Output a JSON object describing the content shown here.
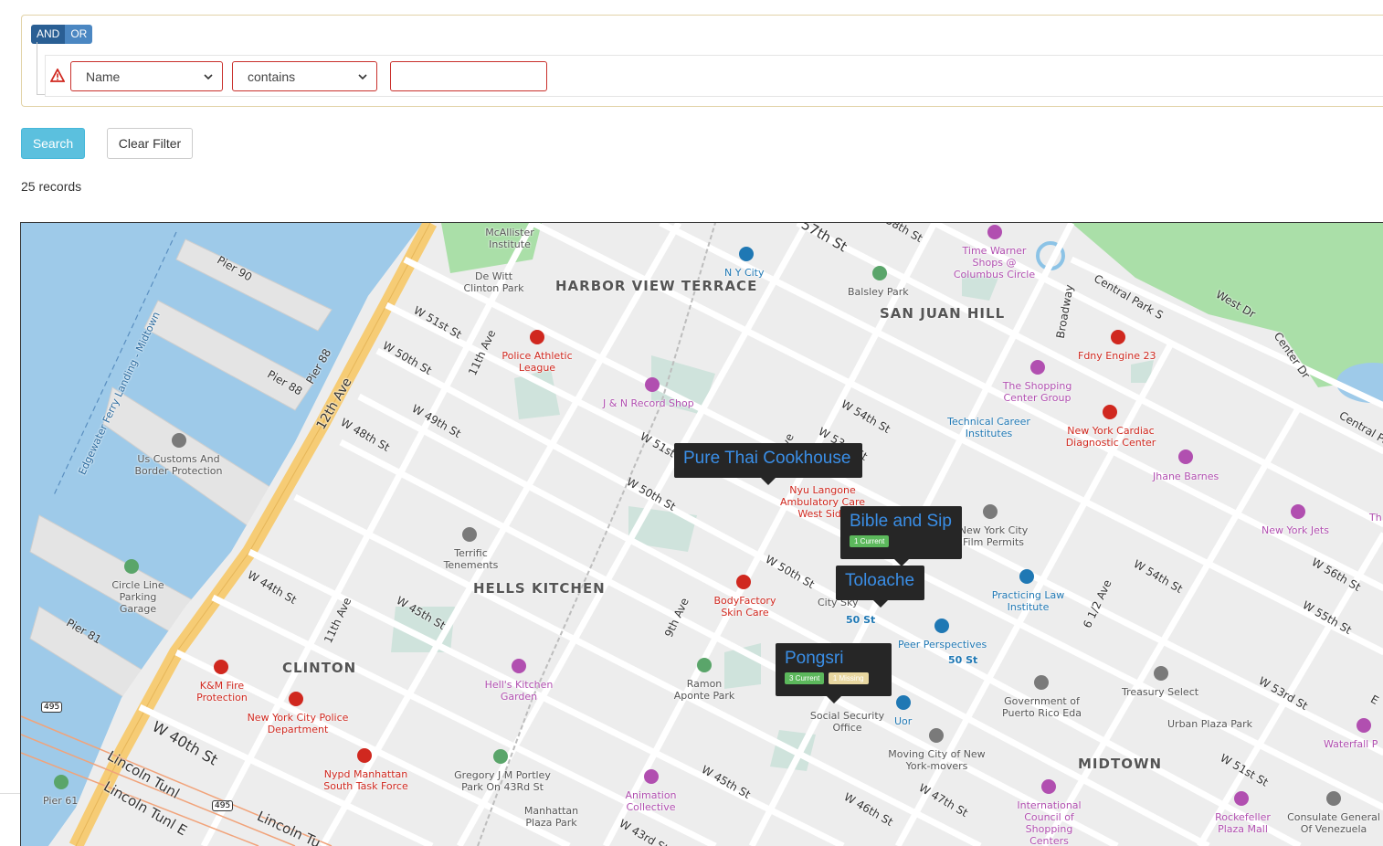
{
  "filter": {
    "and_label": "AND",
    "or_label": "OR",
    "field_value": "Name",
    "operator_value": "contains",
    "text_value": ""
  },
  "buttons": {
    "search_label": "Search",
    "clear_label": "Clear Filter"
  },
  "records_label": "25 records",
  "map": {
    "areas": [
      "HARBOR VIEW TERRACE",
      "SAN JUAN HILL",
      "HELLS KITCHEN",
      "CLINTON",
      "MIDTOWN"
    ],
    "streets": [
      "Pier 90",
      "Pier 88",
      "Pier 88",
      "Pier 81",
      "W 51st St",
      "W 50th St",
      "W 49th St",
      "W 48th St",
      "12th Ave",
      "11th Ave",
      "11th Ave",
      "W 44th St",
      "W 45th St",
      "W 40th St",
      "Lincoln Tunl",
      "Lincoln Tunl E",
      "Lincoln Tu",
      "57th St",
      "58th St",
      "Central Park S",
      "Broadway",
      "West Dr",
      "Center Dr",
      "Central Pa",
      "W 54th St",
      "W 53rd St",
      "W 51st St",
      "W 50th St",
      "9th Ave",
      "9th Ave",
      "W 50th St",
      "W 54th St",
      "W 56th St",
      "W 55th St",
      "6 1/2 Ave",
      "W 53rd St",
      "W 51st St",
      "W 45th St",
      "W 46th St",
      "W 47th St",
      "W 43rd St",
      "E",
      "Edgewater Ferry Landing - Midtown"
    ],
    "pois": [
      {
        "name": "McAllister Institute",
        "color": "gray"
      },
      {
        "name": "De Witt Clinton Park",
        "color": "gray"
      },
      {
        "name": "N Y City",
        "color": "blue"
      },
      {
        "name": "Balsley Park",
        "color": "gray"
      },
      {
        "name": "Time Warner Shops @ Columbus Circle",
        "color": "purple"
      },
      {
        "name": "Police Athletic League",
        "color": "red"
      },
      {
        "name": "Fdny Engine 23",
        "color": "red"
      },
      {
        "name": "J & N Record Shop",
        "color": "purple"
      },
      {
        "name": "The Shopping Center Group",
        "color": "purple"
      },
      {
        "name": "Technical Career Institutes",
        "color": "blue"
      },
      {
        "name": "New York Cardiac Diagnostic Center",
        "color": "red"
      },
      {
        "name": "Us Customs And Border Protection",
        "color": "gray"
      },
      {
        "name": "Nyu Langone Ambulatory Care West Side",
        "color": "red"
      },
      {
        "name": "Jhane Barnes",
        "color": "purple"
      },
      {
        "name": "New York City Film Permits",
        "color": "gray"
      },
      {
        "name": "New York Jets",
        "color": "purple"
      },
      {
        "name": "Terrific Tenements",
        "color": "gray"
      },
      {
        "name": "Circle Line Parking Garage",
        "color": "gray"
      },
      {
        "name": "BodyFactory Skin Care",
        "color": "red"
      },
      {
        "name": "City Sky",
        "color": "gray"
      },
      {
        "name": "Practicing Law Institute",
        "color": "blue"
      },
      {
        "name": "50 St",
        "color": "blue"
      },
      {
        "name": "Peer Perspectives",
        "color": "blue"
      },
      {
        "name": "50 St",
        "color": "blue"
      },
      {
        "name": "K&M Fire Protection",
        "color": "red"
      },
      {
        "name": "Hell's Kitchen Garden",
        "color": "purple"
      },
      {
        "name": "Ramon Aponte Park",
        "color": "gray"
      },
      {
        "name": "Social Security Office",
        "color": "gray"
      },
      {
        "name": "Uor",
        "color": "blue"
      },
      {
        "name": "Government of Puerto Rico Eda",
        "color": "gray"
      },
      {
        "name": "Treasury Select",
        "color": "gray"
      },
      {
        "name": "Urban Plaza Park",
        "color": "gray"
      },
      {
        "name": "New York City Police Department",
        "color": "red"
      },
      {
        "name": "Moving City of New York-movers",
        "color": "gray"
      },
      {
        "name": "Nypd Manhattan South Task Force",
        "color": "red"
      },
      {
        "name": "Gregory J M Portley Park On 43Rd St",
        "color": "gray"
      },
      {
        "name": "Animation Collective",
        "color": "purple"
      },
      {
        "name": "Manhattan Plaza Park",
        "color": "gray"
      },
      {
        "name": "International Council of Shopping Centers",
        "color": "purple"
      },
      {
        "name": "Rockefeller Plaza Mall",
        "color": "purple"
      },
      {
        "name": "Consulate General Of Venezuela",
        "color": "gray"
      },
      {
        "name": "Waterfall P",
        "color": "purple"
      },
      {
        "name": "Pier 61",
        "color": "gray"
      },
      {
        "name": "Th",
        "color": "purple"
      }
    ],
    "shields": [
      "495",
      "495"
    ],
    "markers": [
      {
        "name": "Pure Thai Cookhouse",
        "badges": []
      },
      {
        "name": "Bible and Sip",
        "badges": [
          {
            "text": "1 Current",
            "type": "current"
          }
        ]
      },
      {
        "name": "Toloache",
        "badges": []
      },
      {
        "name": "Pongsri",
        "badges": [
          {
            "text": "3 Current",
            "type": "current"
          },
          {
            "text": "1 Missing",
            "type": "missing"
          }
        ]
      }
    ]
  },
  "colors": {
    "search": "#5bc0de",
    "water": "#9ecae9",
    "park": "#aadfa8",
    "highway": "#f6cc75",
    "tooltip_bg": "#262626",
    "tooltip_text": "#3a8ee6",
    "badge_current": "#5cb85c",
    "badge_missing": "#e8d7a0",
    "error_border": "#c9302c"
  }
}
